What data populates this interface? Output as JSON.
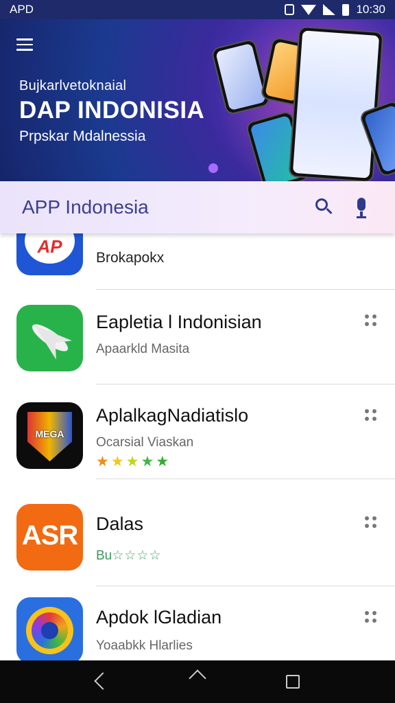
{
  "status_bar": {
    "carrier": "APD",
    "time": "10:30"
  },
  "banner": {
    "line1": "Bujkarlvetoknaial",
    "title": "DAP INDONISIA",
    "line3": "Prpskar Mdalnessia"
  },
  "search": {
    "query": "APP Indonesia"
  },
  "apps": [
    {
      "name": "",
      "subtitle": "Brokapokx",
      "icon": "ap-logo-icon",
      "icon_text": "AP",
      "rating": null
    },
    {
      "name": "Eapletia l Indonisian",
      "subtitle": "Apaarkld Masita",
      "icon": "paper-plane-icon",
      "rating": null
    },
    {
      "name": "AplalkagNadiatislo",
      "subtitle": "Ocarsial Viaskan",
      "icon": "shield-logo-icon",
      "icon_text": "MEGA",
      "rating": 5
    },
    {
      "name": "Dalas",
      "subtitle": "Bu",
      "icon": "asr-logo-icon",
      "icon_text": "ASR",
      "rating": 4
    },
    {
      "name": "Apdok lGladian",
      "subtitle": "Yoaabkk Hlarlies",
      "icon": "sun-ring-icon",
      "rating": null
    }
  ],
  "colors": {
    "status_bar": "#1f2a6b",
    "search_text": "#3b3f8f",
    "star_orange": "#f08a1c",
    "star_yellow": "#f5c518",
    "star_green": "#3fb83f",
    "star_outline_green": "#4aa86a"
  }
}
